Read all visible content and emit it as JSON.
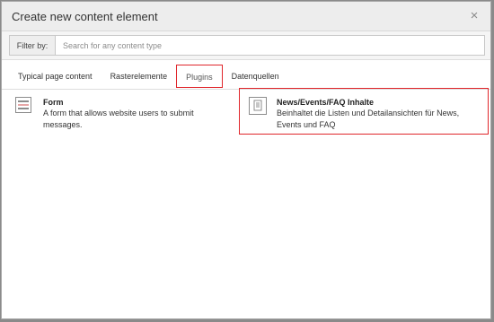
{
  "dialog": {
    "title": "Create new content element",
    "close_symbol": "×"
  },
  "filter": {
    "label": "Filter by:",
    "value": "",
    "placeholder": "Search for any content type"
  },
  "tabs": [
    {
      "label": "Typical page content",
      "active": false
    },
    {
      "label": "Rasterelemente",
      "active": false
    },
    {
      "label": "Plugins",
      "active": true
    },
    {
      "label": "Datenquellen",
      "active": false
    }
  ],
  "elements": [
    {
      "icon": "form-icon",
      "title": "Form",
      "description": "A form that allows website users to submit messages."
    },
    {
      "icon": "news-plugin-icon",
      "title": "News/Events/FAQ Inhalte",
      "description": "Beinhaltet die Listen und Detailansichten für News, Events und FAQ"
    }
  ],
  "colors": {
    "highlight": "#e0262b",
    "header_bg": "#ededed",
    "backdrop": "#8a8a8a"
  }
}
